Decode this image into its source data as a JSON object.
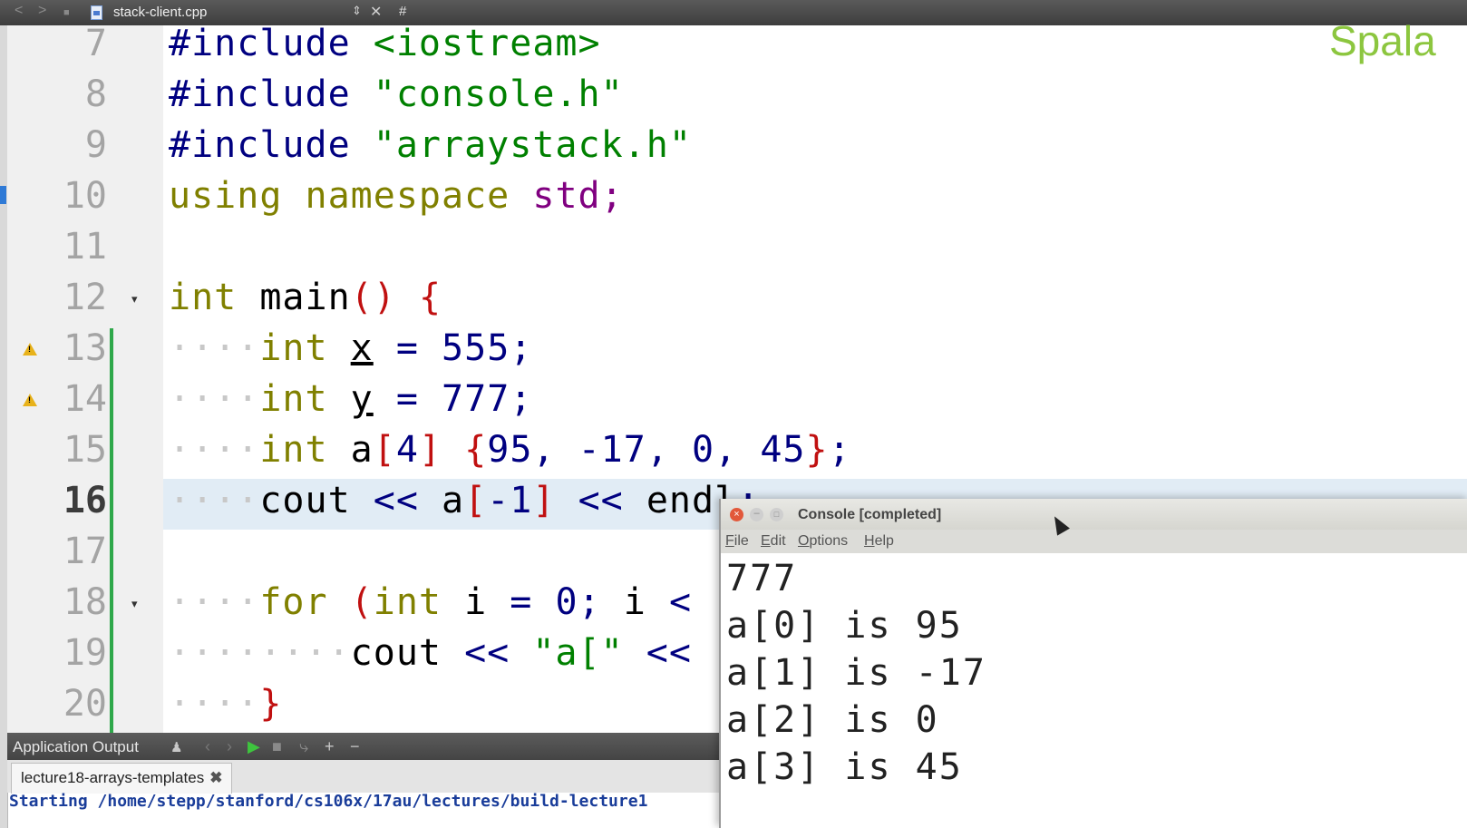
{
  "tab_bar": {
    "file_name": "stack-client.cpp",
    "arrows_glyph": "⇕",
    "close_glyph": "✕",
    "hash": "#"
  },
  "gutter": {
    "lines": [
      "7",
      "8",
      "9",
      "10",
      "11",
      "12",
      "13",
      "14",
      "15",
      "16",
      "17",
      "18",
      "19",
      "20"
    ],
    "current_line": "16",
    "warning_lines": [
      "13",
      "14"
    ],
    "fold_lines": [
      "12",
      "18"
    ]
  },
  "code": {
    "l7": [
      "#include",
      " ",
      "<iostream>"
    ],
    "l8": [
      "#include",
      " ",
      "\"console.h\""
    ],
    "l9": [
      "#include",
      " ",
      "\"arraystack.h\""
    ],
    "l10": [
      "using",
      " ",
      "namespace",
      " ",
      "std",
      ";"
    ],
    "l12": [
      "int",
      " ",
      "main",
      "()",
      " ",
      "{"
    ],
    "l13": [
      "····",
      "int",
      " ",
      "x",
      " ",
      "=",
      " ",
      "555",
      ";"
    ],
    "l14": [
      "····",
      "int",
      " ",
      "y",
      " ",
      "=",
      " ",
      "777",
      ";"
    ],
    "l15": [
      "····",
      "int",
      " ",
      "a",
      "[",
      "4",
      "]",
      " ",
      "{",
      "95",
      ",",
      " ",
      "-17",
      ",",
      " ",
      "0",
      ",",
      " ",
      "45",
      "}",
      ";"
    ],
    "l16": [
      "····",
      "cout",
      " ",
      "<<",
      " ",
      "a",
      "[",
      "-1",
      "]",
      " ",
      "<<",
      " ",
      "endl",
      ";"
    ],
    "l18": [
      "····",
      "for",
      " ",
      "(",
      "int",
      " ",
      "i",
      " ",
      "=",
      " ",
      "0",
      ";",
      " ",
      "i",
      " ",
      "<"
    ],
    "l19": [
      "········",
      "cout",
      " ",
      "<<",
      " ",
      "\"a[\"",
      " ",
      "<<"
    ],
    "l20": [
      "····",
      "}"
    ]
  },
  "brand_text": "Spala",
  "output_pane": {
    "title": "Application Output",
    "tab_label": "lecture18-arrays-templates",
    "text": "Starting /home/stepp/stanford/cs106x/17au/lectures/build-lecture1"
  },
  "console": {
    "title": "Console [completed]",
    "menu": [
      "File",
      "Edit",
      "Options",
      "Help"
    ],
    "lines": [
      "777",
      "a[0] is 95",
      "a[1] is -17",
      "a[2] is 0",
      "a[3] is 45"
    ]
  },
  "colors": {
    "brand": "#8cc63f",
    "current_line_bg": "#e1ecf5",
    "keyword": "#808000",
    "string": "#008000",
    "preprocessor": "#000080",
    "bracket": "#c01010",
    "change_bar": "#2ea84a"
  }
}
